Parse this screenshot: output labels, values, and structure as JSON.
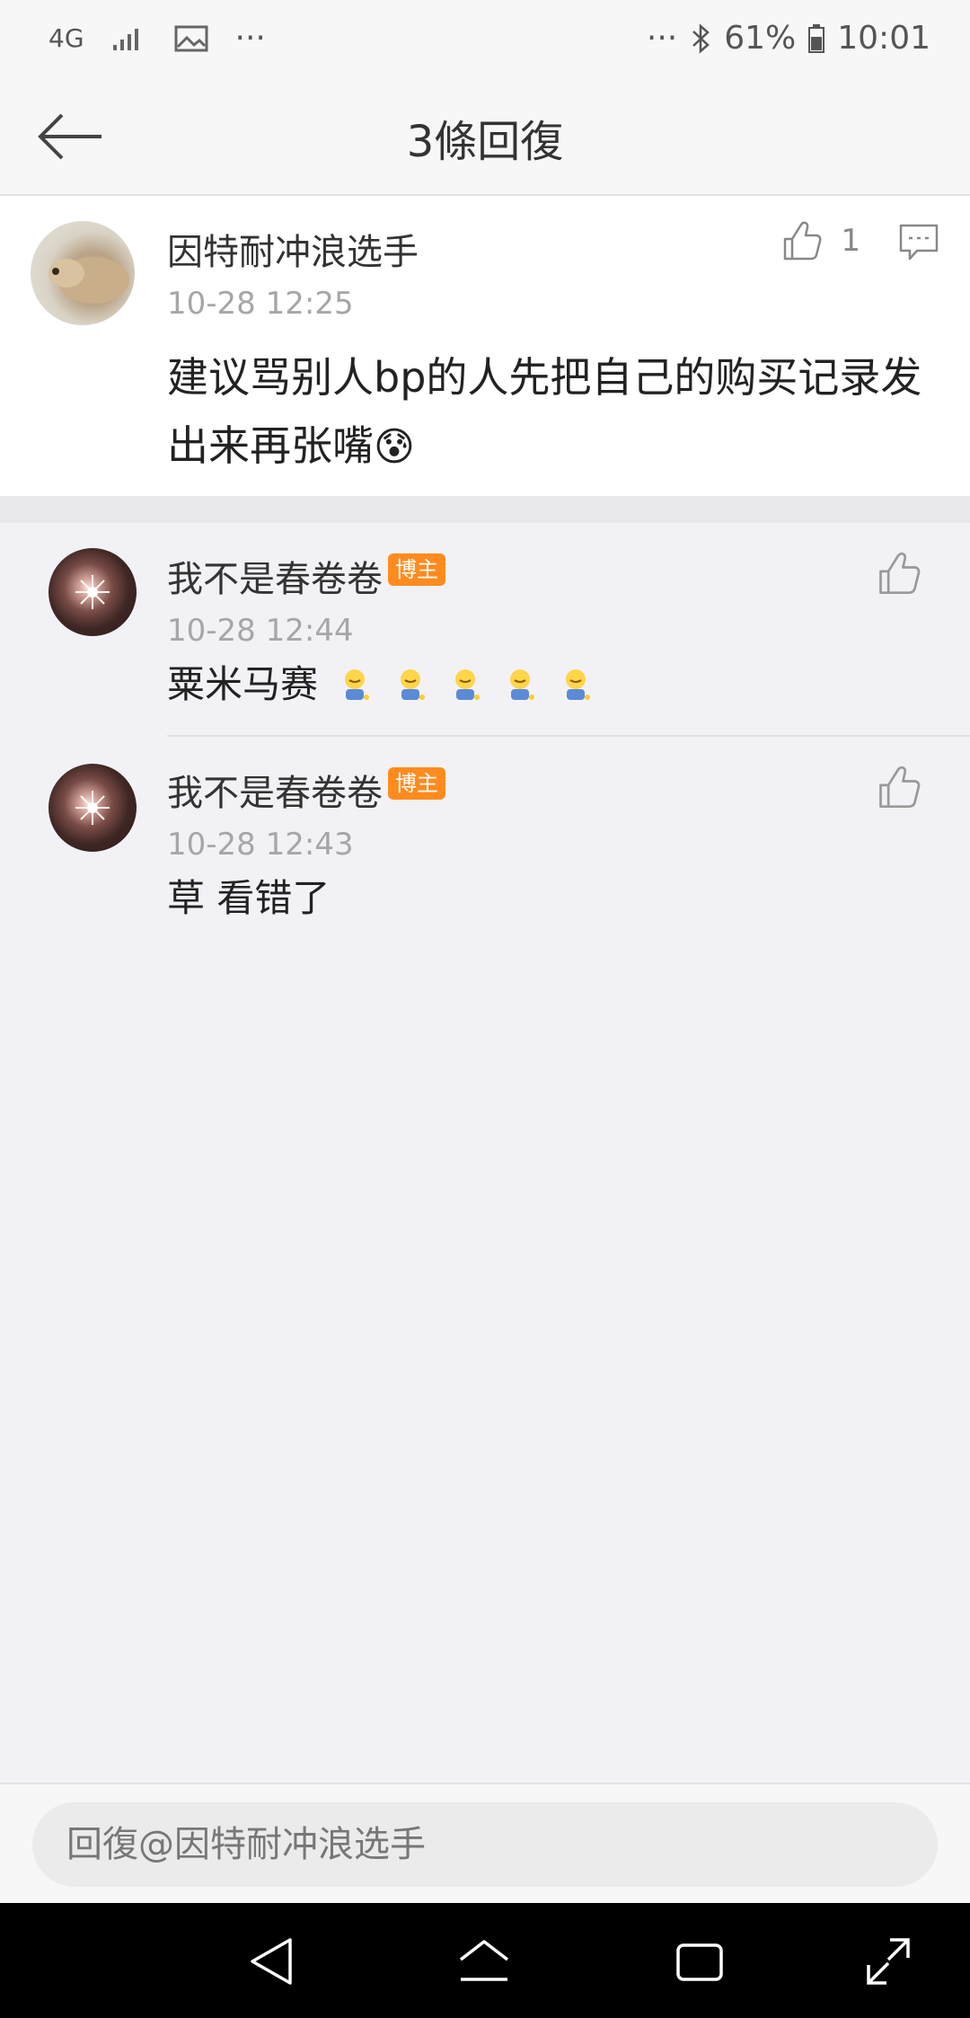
{
  "status_bar": {
    "network": "4G",
    "more": "···",
    "right_more": "···",
    "battery": "61%",
    "time": "10:01"
  },
  "nav": {
    "title": "3條回復"
  },
  "main_comment": {
    "username": "因特耐冲浪选手",
    "timestamp": "10-28 12:25",
    "content": "建议骂别人bp的人先把自己的购买记录发出来再张嘴",
    "emoji": "😰",
    "like_count": "1"
  },
  "replies": [
    {
      "username": "我不是春卷卷",
      "badge": "博主",
      "timestamp": "10-28 12:44",
      "content": "粟米马赛"
    },
    {
      "username": "我不是春卷卷",
      "badge": "博主",
      "timestamp": "10-28 12:43",
      "content": "草 看错了"
    }
  ],
  "reply_bar": {
    "placeholder": "回復@因特耐冲浪选手"
  },
  "colors": {
    "badge": "#ff8b1f",
    "timestamp": "#a6a6a6",
    "background": "#f2f2f6"
  }
}
